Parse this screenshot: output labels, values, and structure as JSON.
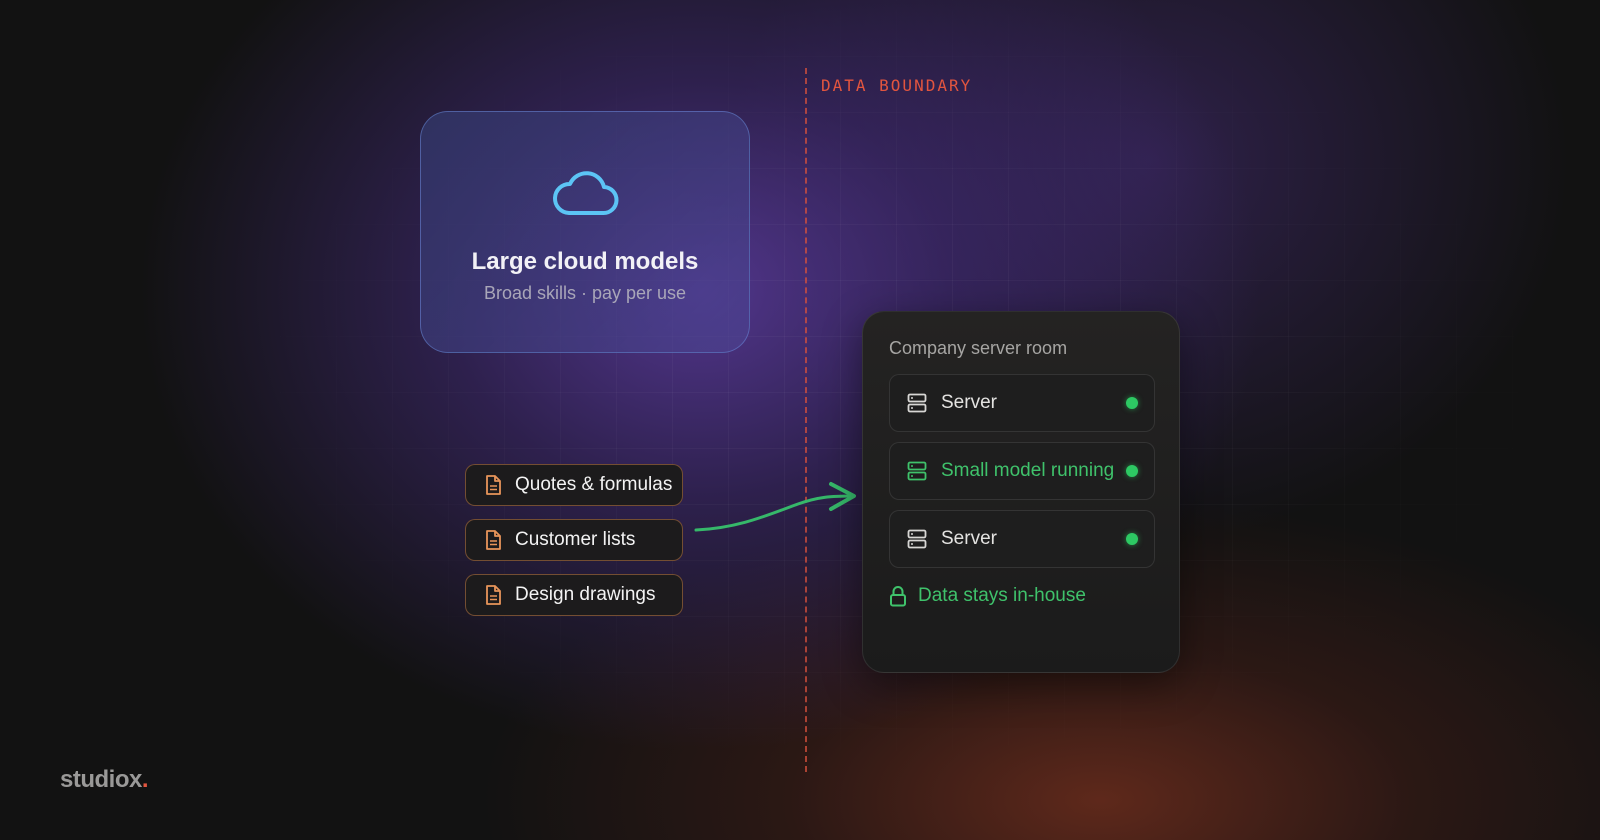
{
  "boundary": {
    "label": "DATA BOUNDARY",
    "color": "#e2553f"
  },
  "cloud": {
    "icon": "cloud-icon",
    "title": "Large cloud models",
    "subtitle": "Broad skills · pay per use",
    "icon_color": "#5cc4f5"
  },
  "documents": [
    {
      "icon": "document-icon",
      "label": "Quotes & formulas"
    },
    {
      "icon": "document-icon",
      "label": "Customer lists"
    },
    {
      "icon": "document-icon",
      "label": "Design drawings"
    }
  ],
  "document_icon_color": "#e8955a",
  "arrow_color": "#36b86a",
  "server_room": {
    "title": "Company server room",
    "servers": [
      {
        "icon": "server-icon",
        "label": "Server",
        "status": "online",
        "active": false
      },
      {
        "icon": "server-icon",
        "label": "Small model running",
        "status": "online",
        "active": true
      },
      {
        "icon": "server-icon",
        "label": "Server",
        "status": "online",
        "active": false
      }
    ],
    "status_color": "#2dc963",
    "footer": {
      "icon": "lock-icon",
      "label": "Data stays in-house"
    }
  },
  "brand": {
    "name": "studiox",
    "dot": "."
  }
}
